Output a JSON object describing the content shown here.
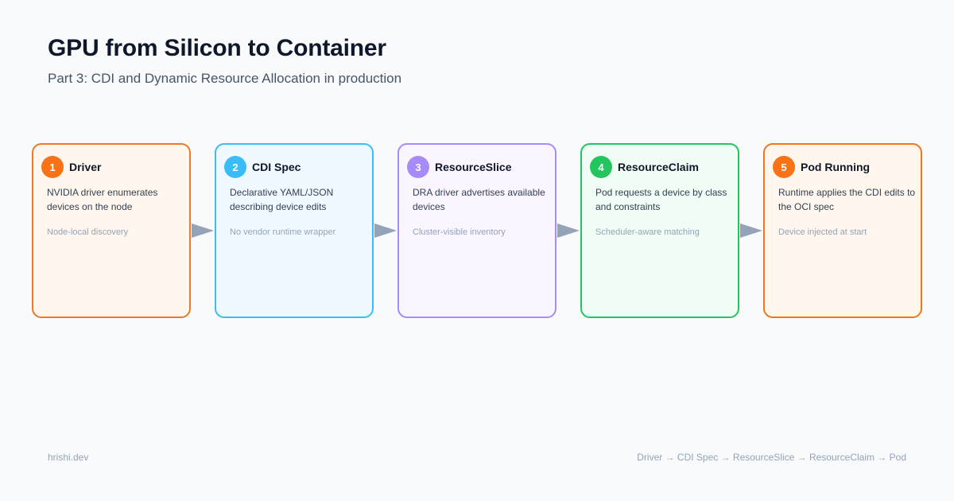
{
  "header": {
    "title": "GPU from Silicon to Container",
    "subtitle": "Part 3: CDI and Dynamic Resource Allocation in production"
  },
  "steps": [
    {
      "number": "1",
      "title": "Driver",
      "description": "NVIDIA driver enumerates devices on the node",
      "note": "Node-local discovery",
      "accent": "#f97316",
      "border": "#ea7a2a",
      "background": "#fff7ed"
    },
    {
      "number": "2",
      "title": "CDI Spec",
      "description": "Declarative YAML/JSON describing device edits",
      "note": "No vendor runtime wrapper",
      "accent": "#38bdf8",
      "border": "#38bdf8",
      "background": "#f0f9ff"
    },
    {
      "number": "3",
      "title": "ResourceSlice",
      "description": "DRA driver advertises available devices",
      "note": "Cluster-visible inventory",
      "accent": "#a78bfa",
      "border": "#a78bfa",
      "background": "#faf5ff"
    },
    {
      "number": "4",
      "title": "ResourceClaim",
      "description": "Pod requests a device by class and constraints",
      "note": "Scheduler-aware matching",
      "accent": "#22c55e",
      "border": "#22c55e",
      "background": "#f0fdf4"
    },
    {
      "number": "5",
      "title": "Pod Running",
      "description": "Runtime applies the CDI edits to the OCI spec",
      "note": "Device injected at start",
      "accent": "#f97316",
      "border": "#f97316",
      "background": "#fff7ed"
    }
  ],
  "arrow_color": "#94a3b8",
  "footer": {
    "site": "hrishi.dev",
    "flow": "Driver → CDI Spec → ResourceSlice → ResourceClaim → Pod"
  }
}
